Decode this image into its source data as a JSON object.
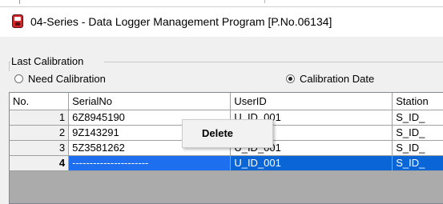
{
  "window": {
    "title": "04-Series - Data Logger Management Program [P.No.06134]",
    "icon": "red-logger-icon"
  },
  "calibration_group": {
    "label": "Last Calibration",
    "options": [
      {
        "label": "Need Calibration",
        "checked": false
      },
      {
        "label": "Calibration Date",
        "checked": true
      }
    ]
  },
  "table": {
    "columns": [
      "No.",
      "SerialNo",
      "UserID",
      "Station"
    ],
    "rows": [
      {
        "no": "1",
        "serial": "6Z8945190",
        "user": "U_ID_001",
        "station": "S_ID_"
      },
      {
        "no": "2",
        "serial": "9Z143291",
        "user": "",
        "station": "S_ID_"
      },
      {
        "no": "3",
        "serial": "5Z3581262",
        "user": "U_ID_001",
        "station": "S_ID_"
      },
      {
        "no": "4",
        "serial": "----------------------",
        "user": "U_ID_001",
        "station": "S_ID_",
        "selected": true
      }
    ]
  },
  "context_menu": {
    "items": [
      "Delete"
    ]
  },
  "colors": {
    "selection": "#0a66d6",
    "icon_red": "#d2262a"
  }
}
